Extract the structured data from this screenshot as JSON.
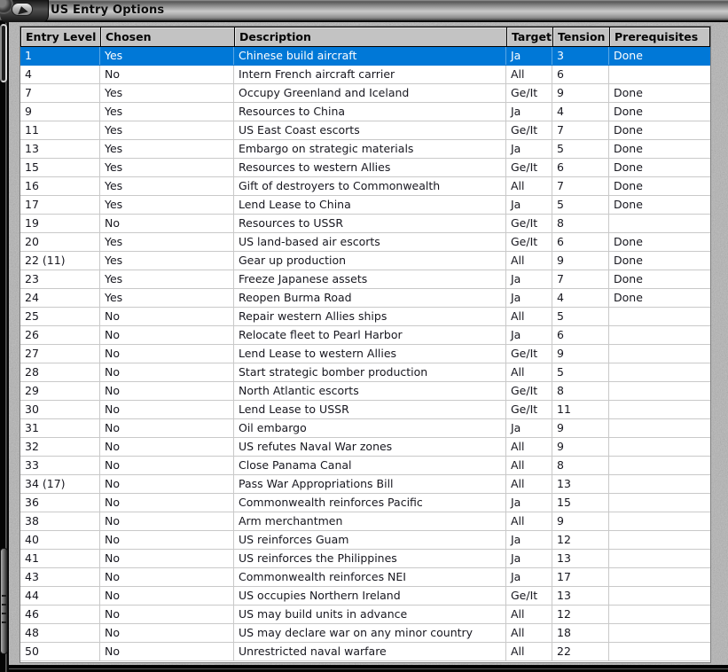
{
  "window": {
    "title": "US Entry Options"
  },
  "colors": {
    "selection_blue": "#0078D7",
    "header_gray": "#C3C3C3",
    "frame_gray": "#B3B3B3"
  },
  "table": {
    "columns": [
      "Entry Level",
      "Chosen",
      "Description",
      "Target",
      "Tension",
      "Prerequisites"
    ],
    "rows": [
      {
        "level": "1",
        "chosen": "Yes",
        "description": "Chinese build aircraft",
        "target": "Ja",
        "tension": "3",
        "prerequisites": "Done",
        "selected": true
      },
      {
        "level": "4",
        "chosen": "No",
        "description": "Intern French aircraft carrier",
        "target": "All",
        "tension": "6",
        "prerequisites": "",
        "selected": false
      },
      {
        "level": "7",
        "chosen": "Yes",
        "description": "Occupy Greenland and Iceland",
        "target": "Ge/It",
        "tension": "9",
        "prerequisites": "Done",
        "selected": false
      },
      {
        "level": "9",
        "chosen": "Yes",
        "description": "Resources to China",
        "target": "Ja",
        "tension": "4",
        "prerequisites": "Done",
        "selected": false
      },
      {
        "level": "11",
        "chosen": "Yes",
        "description": "US East Coast escorts",
        "target": "Ge/It",
        "tension": "7",
        "prerequisites": "Done",
        "selected": false
      },
      {
        "level": "13",
        "chosen": "Yes",
        "description": "Embargo on strategic materials",
        "target": "Ja",
        "tension": "5",
        "prerequisites": "Done",
        "selected": false
      },
      {
        "level": "15",
        "chosen": "Yes",
        "description": "Resources to western Allies",
        "target": "Ge/It",
        "tension": "6",
        "prerequisites": "Done",
        "selected": false
      },
      {
        "level": "16",
        "chosen": "Yes",
        "description": "Gift of destroyers to Commonwealth",
        "target": "All",
        "tension": "7",
        "prerequisites": "Done",
        "selected": false
      },
      {
        "level": "17",
        "chosen": "Yes",
        "description": "Lend Lease to China",
        "target": "Ja",
        "tension": "5",
        "prerequisites": "Done",
        "selected": false
      },
      {
        "level": "19",
        "chosen": "No",
        "description": "Resources to USSR",
        "target": "Ge/It",
        "tension": "8",
        "prerequisites": "",
        "selected": false
      },
      {
        "level": "20",
        "chosen": "Yes",
        "description": "US land-based air escorts",
        "target": "Ge/It",
        "tension": "6",
        "prerequisites": "Done",
        "selected": false
      },
      {
        "level": "22 (11)",
        "chosen": "Yes",
        "description": "Gear up production",
        "target": "All",
        "tension": "9",
        "prerequisites": "Done",
        "selected": false
      },
      {
        "level": "23",
        "chosen": "Yes",
        "description": "Freeze Japanese assets",
        "target": "Ja",
        "tension": "7",
        "prerequisites": "Done",
        "selected": false
      },
      {
        "level": "24",
        "chosen": "Yes",
        "description": "Reopen Burma Road",
        "target": "Ja",
        "tension": "4",
        "prerequisites": "Done",
        "selected": false
      },
      {
        "level": "25",
        "chosen": "No",
        "description": "Repair western Allies ships",
        "target": "All",
        "tension": "5",
        "prerequisites": "",
        "selected": false
      },
      {
        "level": "26",
        "chosen": "No",
        "description": "Relocate fleet to Pearl Harbor",
        "target": "Ja",
        "tension": "6",
        "prerequisites": "",
        "selected": false
      },
      {
        "level": "27",
        "chosen": "No",
        "description": "Lend Lease to western Allies",
        "target": "Ge/It",
        "tension": "9",
        "prerequisites": "",
        "selected": false
      },
      {
        "level": "28",
        "chosen": "No",
        "description": "Start strategic bomber production",
        "target": "All",
        "tension": "5",
        "prerequisites": "",
        "selected": false
      },
      {
        "level": "29",
        "chosen": "No",
        "description": "North Atlantic escorts",
        "target": "Ge/It",
        "tension": "8",
        "prerequisites": "",
        "selected": false
      },
      {
        "level": "30",
        "chosen": "No",
        "description": "Lend Lease to USSR",
        "target": "Ge/It",
        "tension": "11",
        "prerequisites": "",
        "selected": false
      },
      {
        "level": "31",
        "chosen": "No",
        "description": "Oil embargo",
        "target": "Ja",
        "tension": "9",
        "prerequisites": "",
        "selected": false
      },
      {
        "level": "32",
        "chosen": "No",
        "description": "US refutes Naval War zones",
        "target": "All",
        "tension": "9",
        "prerequisites": "",
        "selected": false
      },
      {
        "level": "33",
        "chosen": "No",
        "description": "Close Panama Canal",
        "target": "All",
        "tension": "8",
        "prerequisites": "",
        "selected": false
      },
      {
        "level": "34 (17)",
        "chosen": "No",
        "description": "Pass War Appropriations Bill",
        "target": "All",
        "tension": "13",
        "prerequisites": "",
        "selected": false
      },
      {
        "level": "36",
        "chosen": "No",
        "description": "Commonwealth reinforces Pacific",
        "target": "Ja",
        "tension": "15",
        "prerequisites": "",
        "selected": false
      },
      {
        "level": "38",
        "chosen": "No",
        "description": "Arm merchantmen",
        "target": "All",
        "tension": "9",
        "prerequisites": "",
        "selected": false
      },
      {
        "level": "40",
        "chosen": "No",
        "description": "US reinforces Guam",
        "target": "Ja",
        "tension": "12",
        "prerequisites": "",
        "selected": false
      },
      {
        "level": "41",
        "chosen": "No",
        "description": "US reinforces the Philippines",
        "target": "Ja",
        "tension": "13",
        "prerequisites": "",
        "selected": false
      },
      {
        "level": "43",
        "chosen": "No",
        "description": "Commonwealth reinforces NEI",
        "target": "Ja",
        "tension": "17",
        "prerequisites": "",
        "selected": false
      },
      {
        "level": "44",
        "chosen": "No",
        "description": "US occupies Northern Ireland",
        "target": "Ge/It",
        "tension": "13",
        "prerequisites": "",
        "selected": false
      },
      {
        "level": "46",
        "chosen": "No",
        "description": "US may build units in advance",
        "target": "All",
        "tension": "12",
        "prerequisites": "",
        "selected": false
      },
      {
        "level": "48",
        "chosen": "No",
        "description": "US may declare war on any minor country",
        "target": "All",
        "tension": "18",
        "prerequisites": "",
        "selected": false
      },
      {
        "level": "50",
        "chosen": "No",
        "description": "Unrestricted naval warfare",
        "target": "All",
        "tension": "22",
        "prerequisites": "",
        "selected": false
      }
    ]
  }
}
